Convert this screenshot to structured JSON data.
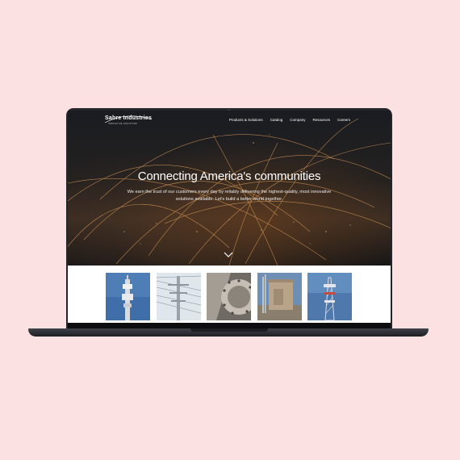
{
  "brand": {
    "name": "Sabre Industries",
    "tagline": "INNOVATIVE SOLUTIONS"
  },
  "nav": {
    "items": [
      "Products & Solutions",
      "Catalog",
      "Company",
      "Resources",
      "Careers"
    ]
  },
  "hero": {
    "title": "Connecting America's communities",
    "subtitle_line1": "We earn the trust of our customers every day by reliably delivering the highest-quality, most innovative",
    "subtitle_line2": "solutions available. Let's build a better world together.",
    "scroll_icon": "chevron-down-icon"
  },
  "tiles": [
    {
      "subject": "cell-tower-monopole"
    },
    {
      "subject": "transmission-tower"
    },
    {
      "subject": "steel-pole-flange"
    },
    {
      "subject": "utility-shelter"
    },
    {
      "subject": "lattice-tower"
    }
  ],
  "colors": {
    "page_background": "#fce1e3",
    "laptop_body": "#23262c",
    "hero_arc": "#e6a25a"
  }
}
